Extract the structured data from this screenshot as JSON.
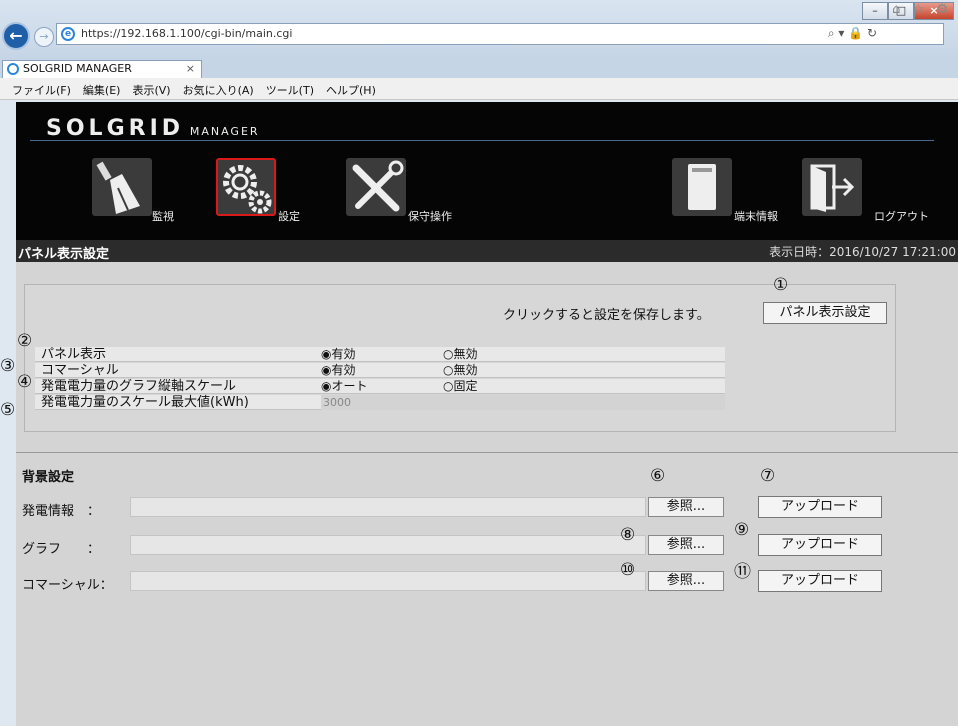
{
  "browser": {
    "url": "https://192.168.1.100/cgi-bin/main.cgi",
    "tab_title": "SOLGRID MANAGER",
    "tab_close": "×",
    "window_controls": [
      "–",
      "□",
      "×"
    ],
    "addr_tools": "⌕ ▾ 🔒 ↻",
    "right_tools": "⌂ ☆ ⚙",
    "menu": [
      "ファイル(F)",
      "編集(E)",
      "表示(V)",
      "お気に入り(A)",
      "ツール(T)",
      "ヘルプ(H)"
    ]
  },
  "header": {
    "logo_main": "SOLGRID",
    "logo_sub": "MANAGER",
    "nav": [
      {
        "label": "監視",
        "icon": "broom-icon"
      },
      {
        "label": "設定",
        "icon": "gears-icon"
      },
      {
        "label": "保守操作",
        "icon": "tools-icon"
      },
      {
        "label": "端末情報",
        "icon": "device-icon"
      },
      {
        "label": "ログアウト",
        "icon": "logout-icon"
      }
    ]
  },
  "title_bar": {
    "title": "パネル表示設定",
    "datetime": "表示日時：2016/10/27 17:21:00"
  },
  "panel": {
    "hint": "クリックすると設定を保存します。",
    "save_button": "パネル表示設定",
    "rows": [
      {
        "label": "パネル表示",
        "opt1": "◉有効",
        "opt2": "○無効"
      },
      {
        "label": "コマーシャル",
        "opt1": "◉有効",
        "opt2": "○無効"
      },
      {
        "label": "発電電力量のグラフ縦軸スケール",
        "opt1": "◉オート",
        "opt2": "○固定"
      },
      {
        "label": "発電電力量のスケール最大値(kWh)",
        "value": "3000"
      }
    ]
  },
  "background": {
    "title": "背景設定",
    "rows": [
      {
        "label": "発電情報　：",
        "browse": "参照...",
        "upload": "アップロード"
      },
      {
        "label": "グラフ　　：",
        "browse": "参照...",
        "upload": "アップロード"
      },
      {
        "label": "コマーシャル：",
        "browse": "参照...",
        "upload": "アップロード"
      }
    ]
  },
  "callouts": [
    "①",
    "②",
    "③",
    "④",
    "⑤",
    "⑥",
    "⑦",
    "⑧",
    "⑨",
    "⑩",
    "⑪"
  ]
}
